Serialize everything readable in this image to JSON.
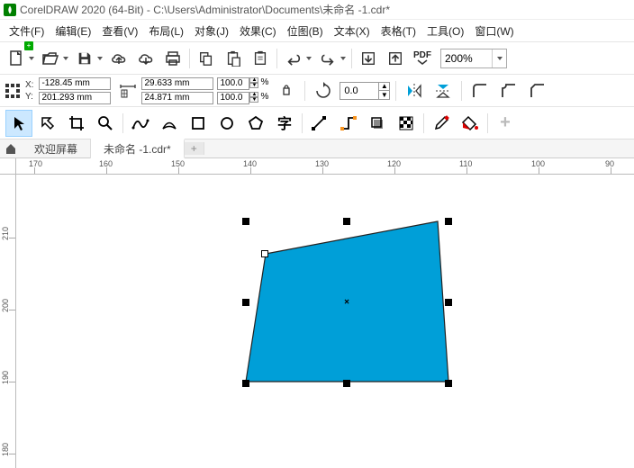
{
  "window": {
    "title": "CorelDRAW 2020 (64-Bit) - C:\\Users\\Administrator\\Documents\\未命名 -1.cdr*"
  },
  "menu": {
    "file": "文件(F)",
    "edit": "编辑(E)",
    "view": "查看(V)",
    "layout": "布局(L)",
    "object": "对象(J)",
    "effects": "效果(C)",
    "bitmap": "位图(B)",
    "text": "文本(X)",
    "table": "表格(T)",
    "tools": "工具(O)",
    "window": "窗口(W)"
  },
  "toolbar1": {
    "pdf_label": "PDF",
    "zoom": "200%"
  },
  "prop": {
    "x_label": "X:",
    "y_label": "Y:",
    "x": "-128.45 mm",
    "y": "201.293 mm",
    "w": "29.633 mm",
    "h": "24.871 mm",
    "sx": "100.0",
    "sy": "100.0",
    "pct": "%",
    "rot": "0.0"
  },
  "tabs": {
    "welcome": "欢迎屏幕",
    "doc": "未命名 -1.cdr*",
    "plus": "+"
  },
  "ruler_h": [
    "170",
    "160",
    "150",
    "140",
    "130",
    "120",
    "110",
    "100",
    "90"
  ],
  "ruler_v": [
    "210",
    "200",
    "190",
    "180"
  ],
  "colors": {
    "shape_fill": "#009fd8",
    "shape_stroke": "#222"
  }
}
